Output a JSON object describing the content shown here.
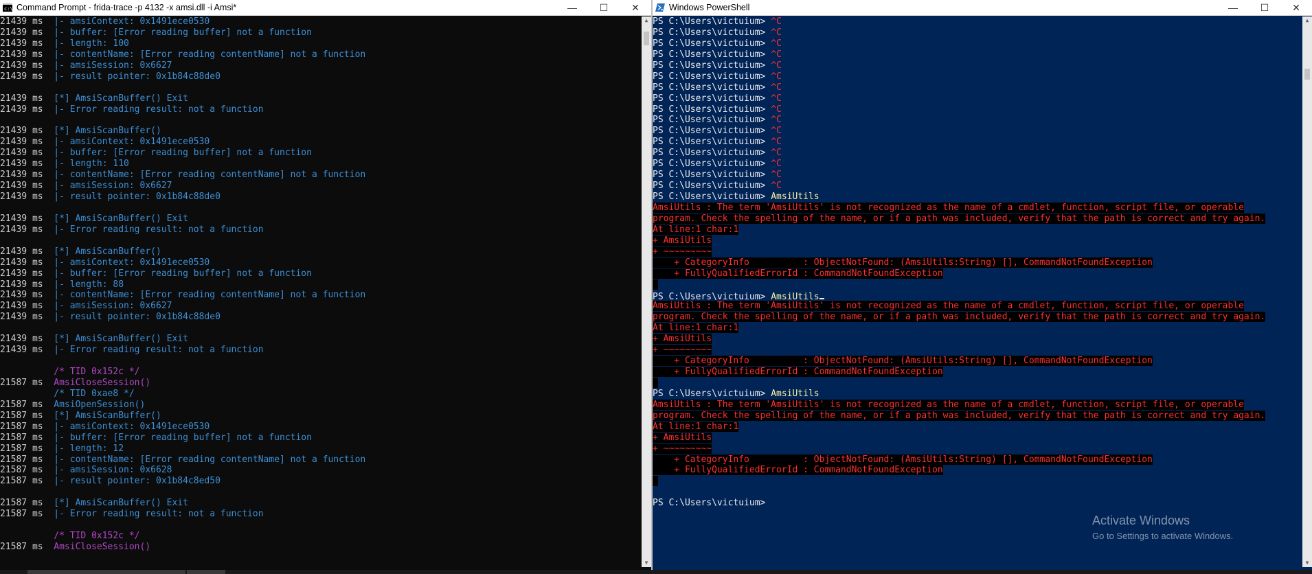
{
  "cmd": {
    "title": "Command Prompt - frida-trace  -p 4132 -x amsi.dll -i Amsi*",
    "lines": [
      [
        {
          "t": "21439 ms  ",
          "c": "t"
        },
        {
          "t": "|- amsiContext: 0x1491ece0530",
          "c": "b"
        }
      ],
      [
        {
          "t": "21439 ms  ",
          "c": "t"
        },
        {
          "t": "|- buffer: [Error reading buffer] not a function",
          "c": "b"
        }
      ],
      [
        {
          "t": "21439 ms  ",
          "c": "t"
        },
        {
          "t": "|- length: 100",
          "c": "b"
        }
      ],
      [
        {
          "t": "21439 ms  ",
          "c": "t"
        },
        {
          "t": "|- contentName: [Error reading contentName] not a function",
          "c": "b"
        }
      ],
      [
        {
          "t": "21439 ms  ",
          "c": "t"
        },
        {
          "t": "|- amsiSession: 0x6627",
          "c": "b"
        }
      ],
      [
        {
          "t": "21439 ms  ",
          "c": "t"
        },
        {
          "t": "|- result pointer: 0x1b84c88de0",
          "c": "b"
        }
      ],
      [],
      [
        {
          "t": "21439 ms  ",
          "c": "t"
        },
        {
          "t": "[*] AmsiScanBuffer() Exit",
          "c": "b"
        }
      ],
      [
        {
          "t": "21439 ms  ",
          "c": "t"
        },
        {
          "t": "|- Error reading result: not a function",
          "c": "b"
        }
      ],
      [],
      [
        {
          "t": "21439 ms  ",
          "c": "t"
        },
        {
          "t": "[*] AmsiScanBuffer()",
          "c": "b"
        }
      ],
      [
        {
          "t": "21439 ms  ",
          "c": "t"
        },
        {
          "t": "|- amsiContext: 0x1491ece0530",
          "c": "b"
        }
      ],
      [
        {
          "t": "21439 ms  ",
          "c": "t"
        },
        {
          "t": "|- buffer: [Error reading buffer] not a function",
          "c": "b"
        }
      ],
      [
        {
          "t": "21439 ms  ",
          "c": "t"
        },
        {
          "t": "|- length: 110",
          "c": "b"
        }
      ],
      [
        {
          "t": "21439 ms  ",
          "c": "t"
        },
        {
          "t": "|- contentName: [Error reading contentName] not a function",
          "c": "b"
        }
      ],
      [
        {
          "t": "21439 ms  ",
          "c": "t"
        },
        {
          "t": "|- amsiSession: 0x6627",
          "c": "b"
        }
      ],
      [
        {
          "t": "21439 ms  ",
          "c": "t"
        },
        {
          "t": "|- result pointer: 0x1b84c88de0",
          "c": "b"
        }
      ],
      [],
      [
        {
          "t": "21439 ms  ",
          "c": "t"
        },
        {
          "t": "[*] AmsiScanBuffer() Exit",
          "c": "b"
        }
      ],
      [
        {
          "t": "21439 ms  ",
          "c": "t"
        },
        {
          "t": "|- Error reading result: not a function",
          "c": "b"
        }
      ],
      [],
      [
        {
          "t": "21439 ms  ",
          "c": "t"
        },
        {
          "t": "[*] AmsiScanBuffer()",
          "c": "b"
        }
      ],
      [
        {
          "t": "21439 ms  ",
          "c": "t"
        },
        {
          "t": "|- amsiContext: 0x1491ece0530",
          "c": "b"
        }
      ],
      [
        {
          "t": "21439 ms  ",
          "c": "t"
        },
        {
          "t": "|- buffer: [Error reading buffer] not a function",
          "c": "b"
        }
      ],
      [
        {
          "t": "21439 ms  ",
          "c": "t"
        },
        {
          "t": "|- length: 88",
          "c": "b"
        }
      ],
      [
        {
          "t": "21439 ms  ",
          "c": "t"
        },
        {
          "t": "|- contentName: [Error reading contentName] not a function",
          "c": "b"
        }
      ],
      [
        {
          "t": "21439 ms  ",
          "c": "t"
        },
        {
          "t": "|- amsiSession: 0x6627",
          "c": "b"
        }
      ],
      [
        {
          "t": "21439 ms  ",
          "c": "t"
        },
        {
          "t": "|- result pointer: 0x1b84c88de0",
          "c": "b"
        }
      ],
      [],
      [
        {
          "t": "21439 ms  ",
          "c": "t"
        },
        {
          "t": "[*] AmsiScanBuffer() Exit",
          "c": "b"
        }
      ],
      [
        {
          "t": "21439 ms  ",
          "c": "t"
        },
        {
          "t": "|- Error reading result: not a function",
          "c": "b"
        }
      ],
      [],
      [
        {
          "t": "          ",
          "c": "t"
        },
        {
          "t": "/* TID 0x152c */",
          "c": "m"
        }
      ],
      [
        {
          "t": "21587 ms  ",
          "c": "t"
        },
        {
          "t": "AmsiCloseSession()",
          "c": "m"
        }
      ],
      [
        {
          "t": "          ",
          "c": "t"
        },
        {
          "t": "/* TID 0xae8 */",
          "c": "b"
        }
      ],
      [
        {
          "t": "21587 ms  ",
          "c": "t"
        },
        {
          "t": "AmsiOpenSession()",
          "c": "b"
        }
      ],
      [
        {
          "t": "21587 ms  ",
          "c": "t"
        },
        {
          "t": "[*] AmsiScanBuffer()",
          "c": "b"
        }
      ],
      [
        {
          "t": "21587 ms  ",
          "c": "t"
        },
        {
          "t": "|- amsiContext: 0x1491ece0530",
          "c": "b"
        }
      ],
      [
        {
          "t": "21587 ms  ",
          "c": "t"
        },
        {
          "t": "|- buffer: [Error reading buffer] not a function",
          "c": "b"
        }
      ],
      [
        {
          "t": "21587 ms  ",
          "c": "t"
        },
        {
          "t": "|- length: 12",
          "c": "b"
        }
      ],
      [
        {
          "t": "21587 ms  ",
          "c": "t"
        },
        {
          "t": "|- contentName: [Error reading contentName] not a function",
          "c": "b"
        }
      ],
      [
        {
          "t": "21587 ms  ",
          "c": "t"
        },
        {
          "t": "|- amsiSession: 0x6628",
          "c": "b"
        }
      ],
      [
        {
          "t": "21587 ms  ",
          "c": "t"
        },
        {
          "t": "|- result pointer: 0x1b84c8ed50",
          "c": "b"
        }
      ],
      [],
      [
        {
          "t": "21587 ms  ",
          "c": "t"
        },
        {
          "t": "[*] AmsiScanBuffer() Exit",
          "c": "b"
        }
      ],
      [
        {
          "t": "21587 ms  ",
          "c": "t"
        },
        {
          "t": "|- Error reading result: not a function",
          "c": "b"
        }
      ],
      [],
      [
        {
          "t": "          ",
          "c": "t"
        },
        {
          "t": "/* TID 0x152c */",
          "c": "m"
        }
      ],
      [
        {
          "t": "21587 ms  ",
          "c": "t"
        },
        {
          "t": "AmsiCloseSession()",
          "c": "m"
        }
      ]
    ]
  },
  "ps": {
    "title": "Windows PowerShell",
    "lines": [
      [
        {
          "t": "PS C:\\Users\\victuium> ",
          "c": "w"
        },
        {
          "t": "^C",
          "c": "plain"
        }
      ],
      [
        {
          "t": "PS C:\\Users\\victuium> ",
          "c": "w"
        },
        {
          "t": "^C",
          "c": "plain"
        }
      ],
      [
        {
          "t": "PS C:\\Users\\victuium> ",
          "c": "w"
        },
        {
          "t": "^C",
          "c": "plain"
        }
      ],
      [
        {
          "t": "PS C:\\Users\\victuium> ",
          "c": "w"
        },
        {
          "t": "^C",
          "c": "plain"
        }
      ],
      [
        {
          "t": "PS C:\\Users\\victuium> ",
          "c": "w"
        },
        {
          "t": "^C",
          "c": "plain"
        }
      ],
      [
        {
          "t": "PS C:\\Users\\victuium> ",
          "c": "w"
        },
        {
          "t": "^C",
          "c": "plain"
        }
      ],
      [
        {
          "t": "PS C:\\Users\\victuium> ",
          "c": "w"
        },
        {
          "t": "^C",
          "c": "plain"
        }
      ],
      [
        {
          "t": "PS C:\\Users\\victuium> ",
          "c": "w"
        },
        {
          "t": "^C",
          "c": "plain"
        }
      ],
      [
        {
          "t": "PS C:\\Users\\victuium> ",
          "c": "w"
        },
        {
          "t": "^C",
          "c": "plain"
        }
      ],
      [
        {
          "t": "PS C:\\Users\\victuium> ",
          "c": "w"
        },
        {
          "t": "^C",
          "c": "plain"
        }
      ],
      [
        {
          "t": "PS C:\\Users\\victuium> ",
          "c": "w"
        },
        {
          "t": "^C",
          "c": "plain"
        }
      ],
      [
        {
          "t": "PS C:\\Users\\victuium> ",
          "c": "w"
        },
        {
          "t": "^C",
          "c": "plain"
        }
      ],
      [
        {
          "t": "PS C:\\Users\\victuium> ",
          "c": "w"
        },
        {
          "t": "^C",
          "c": "plain"
        }
      ],
      [
        {
          "t": "PS C:\\Users\\victuium> ",
          "c": "w"
        },
        {
          "t": "^C",
          "c": "plain"
        }
      ],
      [
        {
          "t": "PS C:\\Users\\victuium> ",
          "c": "w"
        },
        {
          "t": "^C",
          "c": "plain"
        }
      ],
      [
        {
          "t": "PS C:\\Users\\victuium> ",
          "c": "w"
        },
        {
          "t": "^C",
          "c": "plain"
        }
      ],
      [
        {
          "t": "PS C:\\Users\\victuium> ",
          "c": "w"
        },
        {
          "t": "AmsiUtils",
          "c": "y"
        }
      ],
      [
        {
          "t": "AmsiUtils : The term 'AmsiUtils' is not recognized as the name of a cmdlet, function, script file, or operable",
          "c": "e"
        }
      ],
      [
        {
          "t": "program. Check the spelling of the name, or if a path was included, verify that the path is correct and try again.",
          "c": "e"
        }
      ],
      [
        {
          "t": "At line:1 char:1",
          "c": "e"
        }
      ],
      [
        {
          "t": "+ AmsiUtils",
          "c": "e"
        }
      ],
      [
        {
          "t": "+ ~~~~~~~~~",
          "c": "e"
        }
      ],
      [
        {
          "t": "    + CategoryInfo          : ObjectNotFound: (AmsiUtils:String) [], CommandNotFoundException",
          "c": "e"
        }
      ],
      [
        {
          "t": "    + FullyQualifiedErrorId : CommandNotFoundException",
          "c": "e"
        }
      ],
      [
        {
          "t": " ",
          "c": "e"
        }
      ],
      [
        {
          "t": "PS C:\\Users\\victuium> ",
          "c": "w"
        },
        {
          "t": "AmsiUtils",
          "c": "y"
        },
        {
          "t": "",
          "c": "caret"
        }
      ],
      [
        {
          "t": "AmsiUtils : The term 'AmsiUtils' is not recognized as the name of a cmdlet, function, script file, or operable",
          "c": "e"
        }
      ],
      [
        {
          "t": "program. Check the spelling of the name, or if a path was included, verify that the path is correct and try again.",
          "c": "e"
        }
      ],
      [
        {
          "t": "At line:1 char:1",
          "c": "e"
        }
      ],
      [
        {
          "t": "+ AmsiUtils",
          "c": "e"
        }
      ],
      [
        {
          "t": "+ ~~~~~~~~~",
          "c": "e"
        }
      ],
      [
        {
          "t": "    + CategoryInfo          : ObjectNotFound: (AmsiUtils:String) [], CommandNotFoundException",
          "c": "e"
        }
      ],
      [
        {
          "t": "    + FullyQualifiedErrorId : CommandNotFoundException",
          "c": "e"
        }
      ],
      [
        {
          "t": " ",
          "c": "e"
        }
      ],
      [
        {
          "t": "PS C:\\Users\\victuium> ",
          "c": "w"
        },
        {
          "t": "AmsiUtils",
          "c": "y"
        }
      ],
      [
        {
          "t": "AmsiUtils : The term 'AmsiUtils' is not recognized as the name of a cmdlet, function, script file, or operable",
          "c": "e"
        }
      ],
      [
        {
          "t": "program. Check the spelling of the name, or if a path was included, verify that the path is correct and try again.",
          "c": "e"
        }
      ],
      [
        {
          "t": "At line:1 char:1",
          "c": "e"
        }
      ],
      [
        {
          "t": "+ AmsiUtils",
          "c": "e"
        }
      ],
      [
        {
          "t": "+ ~~~~~~~~~",
          "c": "e"
        }
      ],
      [
        {
          "t": "    + CategoryInfo          : ObjectNotFound: (AmsiUtils:String) [], CommandNotFoundException",
          "c": "e"
        }
      ],
      [
        {
          "t": "    + FullyQualifiedErrorId : CommandNotFoundException",
          "c": "e"
        }
      ],
      [
        {
          "t": " ",
          "c": "e"
        }
      ],
      [],
      [
        {
          "t": "PS C:\\Users\\victuium> ",
          "c": "w"
        }
      ]
    ]
  },
  "controls": {
    "minimize": "—",
    "maximize": "☐",
    "close": "✕"
  },
  "watermark": {
    "title": "Activate Windows",
    "subtitle": "Go to Settings to activate Windows."
  }
}
